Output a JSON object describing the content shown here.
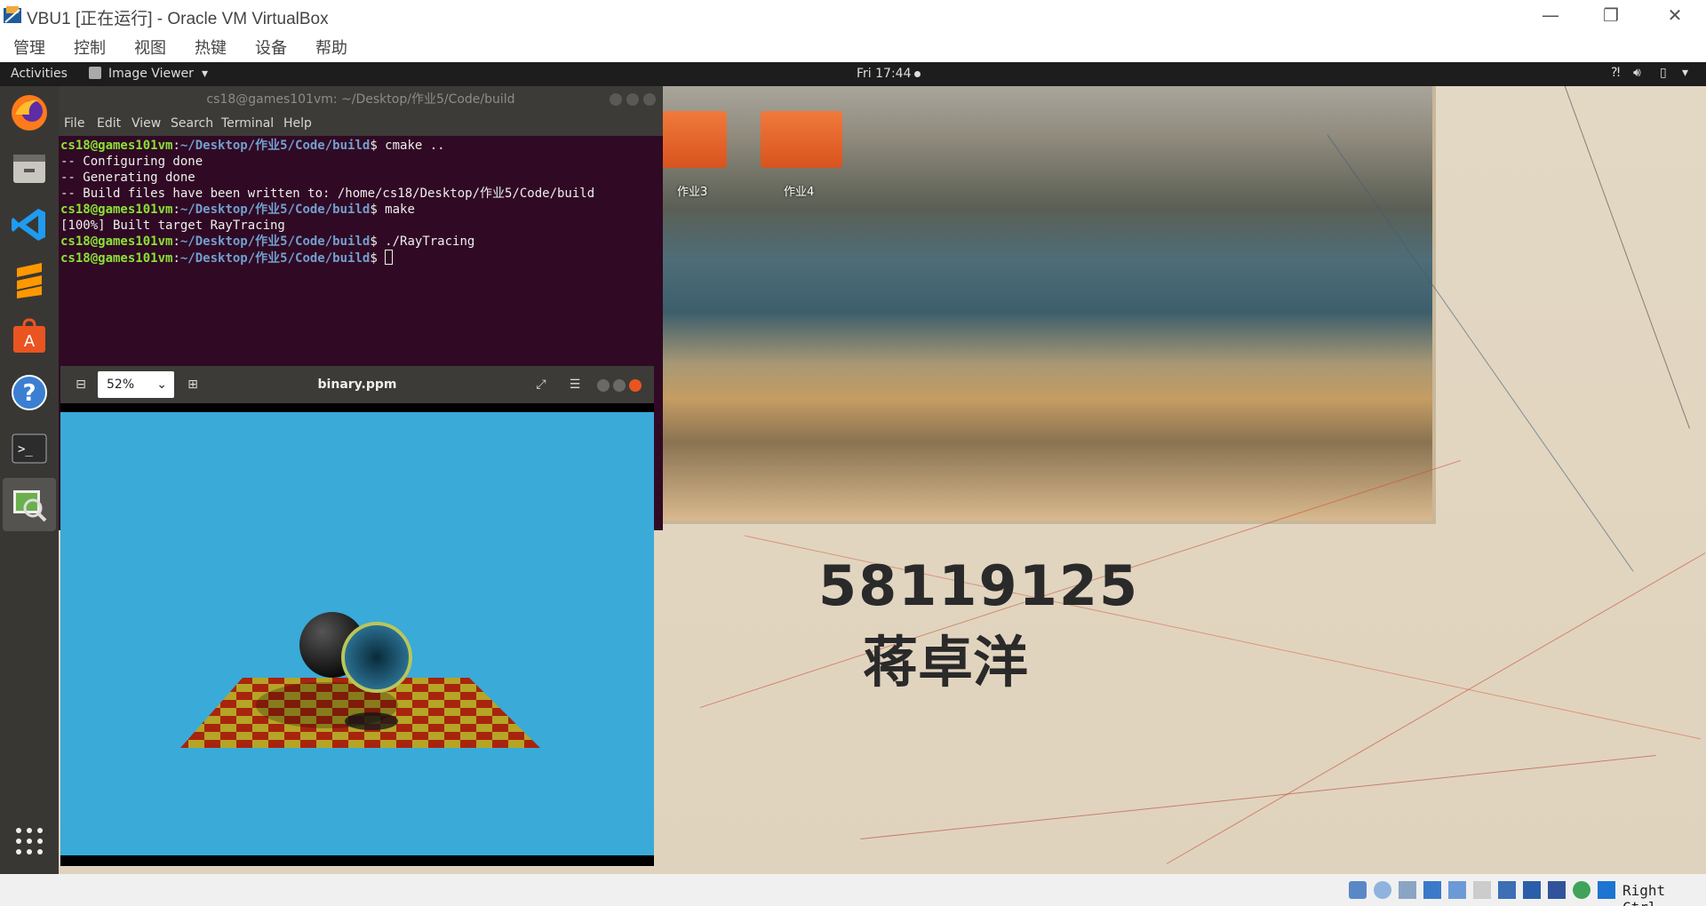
{
  "host": {
    "title": "VBU1 [正在运行] - Oracle VM VirtualBox",
    "menu": [
      "管理",
      "控制",
      "视图",
      "热键",
      "设备",
      "帮助"
    ],
    "controls": {
      "minimize": "—",
      "restore": "❐",
      "close": "✕"
    },
    "host_key": "Right Ctrl"
  },
  "gnome": {
    "activities": "Activities",
    "app_menu": "Image Viewer",
    "clock": "Fri 17:44",
    "desktop_icons": [
      {
        "label": "作业3"
      },
      {
        "label": "作业4"
      }
    ],
    "wallpaper_text": {
      "number": "58119125",
      "name": "蒋卓洋"
    }
  },
  "dock": {
    "items": [
      "firefox-icon",
      "files-icon",
      "vscode-icon",
      "sublime-text-icon",
      "software-center-icon",
      "help-icon",
      "terminal-icon",
      "image-viewer-icon"
    ],
    "app_grid": "show-applications-icon"
  },
  "terminal": {
    "title": "cs18@games101vm: ~/Desktop/作业5/Code/build",
    "menu": [
      "File",
      "Edit",
      "View",
      "Search",
      "Terminal",
      "Help"
    ],
    "lines": [
      {
        "user": "cs18@games101vm",
        "path": "~/Desktop/作业5/Code/build",
        "cmd": "cmake .."
      },
      {
        "text": "-- Configuring done"
      },
      {
        "text": "-- Generating done"
      },
      {
        "text": "-- Build files have been written to: /home/cs18/Desktop/作业5/Code/build"
      },
      {
        "user": "cs18@games101vm",
        "path": "~/Desktop/作业5/Code/build",
        "cmd": "make"
      },
      {
        "text": "[100%] Built target RayTracing"
      },
      {
        "user": "cs18@games101vm",
        "path": "~/Desktop/作业5/Code/build",
        "cmd": "./RayTracing"
      },
      {
        "user": "cs18@games101vm",
        "path": "~/Desktop/作业5/Code/build",
        "cmd": ""
      }
    ]
  },
  "viewer": {
    "title": "binary.ppm",
    "zoom": "52%",
    "background": "#3aaad8"
  },
  "colors": {
    "terminal_bg": "#300a24",
    "prompt_user": "#8ae234",
    "prompt_path": "#729fcf",
    "dock_bg": "#393734",
    "topbar_bg": "#1d1d1d",
    "checker_a": "#b5a426",
    "checker_b": "#a8240d"
  }
}
